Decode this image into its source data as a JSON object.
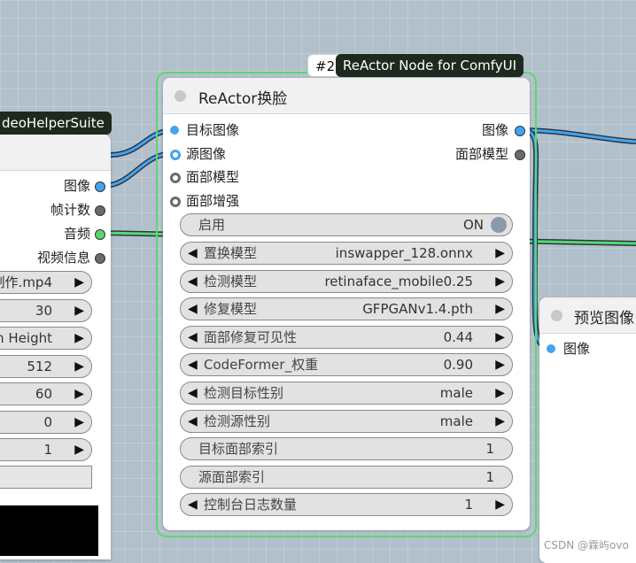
{
  "left_node": {
    "title_partial": "deoHelperSuite",
    "outputs": [
      {
        "label": "图像",
        "color": "#44a4f0"
      },
      {
        "label": "帧计数",
        "color": "#6a6a6a"
      },
      {
        "label": "音频",
        "color": "#5ad86e"
      },
      {
        "label": "视频信息",
        "color": "#6a6a6a"
      }
    ],
    "widgets": [
      {
        "label": "制作.mp4"
      },
      {
        "label": "30"
      },
      {
        "label": "m Height"
      },
      {
        "label": "512"
      },
      {
        "label": "60"
      },
      {
        "label": "0"
      },
      {
        "label": "1"
      }
    ]
  },
  "main_node": {
    "id_badge": "#2",
    "type_badge": "ReActor Node for ComfyUI",
    "title": "ReActor换脸",
    "inputs": [
      {
        "label": "目标图像",
        "color": "#44a4f0"
      },
      {
        "label": "源图像",
        "color": "#44a4f0"
      },
      {
        "label": "面部模型",
        "color": "#6a6a6a"
      },
      {
        "label": "面部增强",
        "color": "#6a6a6a"
      }
    ],
    "outputs": [
      {
        "label": "图像",
        "color": "#44a4f0"
      },
      {
        "label": "面部模型",
        "color": "#6a6a6a"
      }
    ],
    "toggle": {
      "label": "启用",
      "value": "ON"
    },
    "widgets": [
      {
        "label": "置换模型",
        "value": "inswapper_128.onnx",
        "arrows": true
      },
      {
        "label": "检测模型",
        "value": "retinaface_mobile0.25",
        "arrows": true
      },
      {
        "label": "修复模型",
        "value": "GFPGANv1.4.pth",
        "arrows": true
      },
      {
        "label": "面部修复可见性",
        "value": "0.44",
        "arrows": true
      },
      {
        "label": "CodeFormer_权重",
        "value": "0.90",
        "arrows": true
      },
      {
        "label": "检测目标性别",
        "value": "male",
        "arrows": true
      },
      {
        "label": "检测源性别",
        "value": "male",
        "arrows": true
      },
      {
        "label": "目标面部索引",
        "value": "1",
        "arrows": false
      },
      {
        "label": "源面部索引",
        "value": "1",
        "arrows": false
      },
      {
        "label": "控制台日志数量",
        "value": "1",
        "arrows": true
      }
    ]
  },
  "right_node": {
    "title_partial": "预览图像",
    "inputs": [
      {
        "label": "图像",
        "color": "#44a4f0"
      }
    ]
  },
  "watermark": "CSDN @霖屿ovo",
  "colors": {
    "image_link": "#44a4f0",
    "audio_link": "#5ad86e",
    "selection_outline": "#5ad86e",
    "badge_bg": "#1e2a1e"
  }
}
